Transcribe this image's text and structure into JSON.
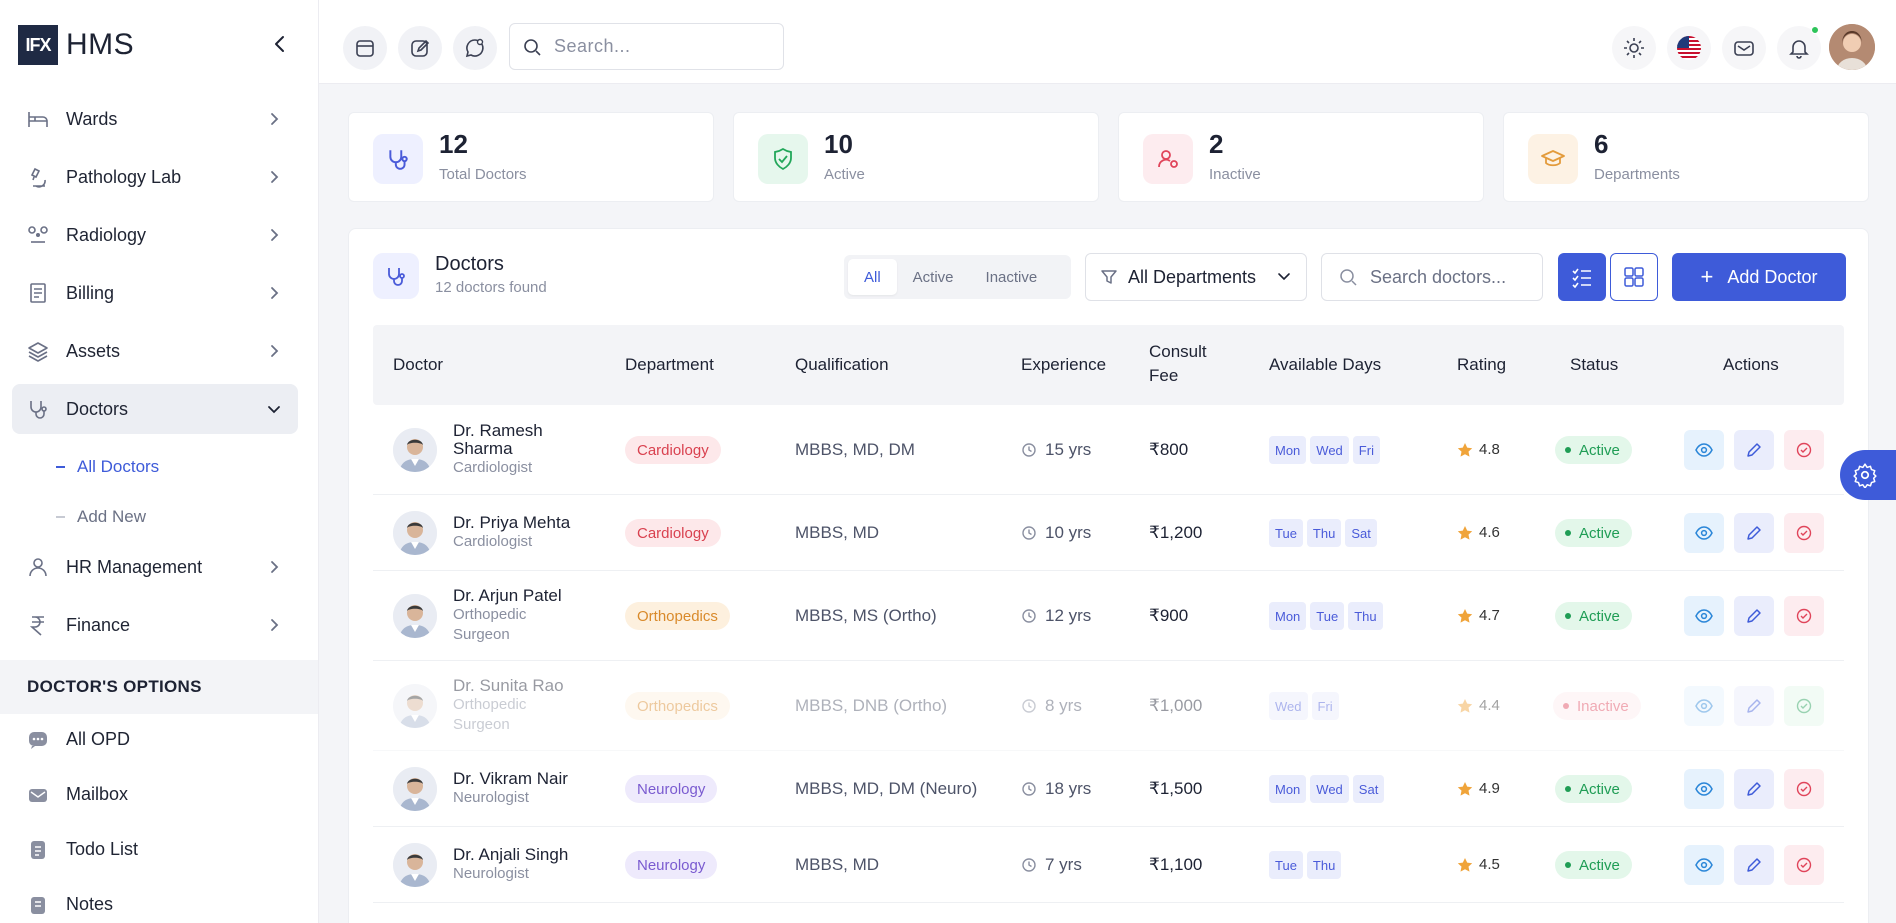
{
  "brand": {
    "logo_text": "IFX",
    "name": "HMS"
  },
  "sidebar": {
    "items": [
      {
        "label": "Wards"
      },
      {
        "label": "Pathology Lab"
      },
      {
        "label": "Radiology"
      },
      {
        "label": "Billing"
      },
      {
        "label": "Assets"
      },
      {
        "label": "Doctors"
      },
      {
        "label": "HR Management"
      },
      {
        "label": "Finance"
      }
    ],
    "doctors_sub": [
      {
        "label": "All Doctors"
      },
      {
        "label": "Add New"
      }
    ],
    "section_title": "DOCTOR'S OPTIONS",
    "options": [
      {
        "label": "All OPD"
      },
      {
        "label": "Mailbox"
      },
      {
        "label": "Todo List"
      },
      {
        "label": "Notes"
      }
    ]
  },
  "topbar": {
    "search_placeholder": "Search..."
  },
  "stats": [
    {
      "value": "12",
      "label": "Total Doctors",
      "color": "#4a5bd9",
      "bg": "#eef0ff"
    },
    {
      "value": "10",
      "label": "Active",
      "color": "#22a75a",
      "bg": "#e6f7ed"
    },
    {
      "value": "2",
      "label": "Inactive",
      "color": "#e0445a",
      "bg": "#fdecef"
    },
    {
      "value": "6",
      "label": "Departments",
      "color": "#e39b3b",
      "bg": "#fdf2e4"
    }
  ],
  "panel": {
    "title": "Doctors",
    "subtitle": "12 doctors found",
    "filters": [
      "All",
      "Active",
      "Inactive"
    ],
    "department_filter": "All Departments",
    "search_placeholder": "Search doctors...",
    "add_button": "Add Doctor"
  },
  "table": {
    "headers": {
      "doctor": "Doctor",
      "department": "Department",
      "qualification": "Qualification",
      "experience": "Experience",
      "fee_line1": "Consult",
      "fee_line2": "Fee",
      "days": "Available Days",
      "rating": "Rating",
      "status": "Status",
      "actions": "Actions"
    },
    "rows": [
      {
        "name1": "Dr. Ramesh",
        "name2": "Sharma",
        "spec1": "Cardiologist",
        "spec2": "",
        "dept": "Cardiology",
        "qual": "MBBS, MD, DM",
        "exp": "15 yrs",
        "fee": "₹800",
        "days": [
          "Mon",
          "Wed",
          "Fri"
        ],
        "rating": "4.8",
        "status": "Active"
      },
      {
        "name1": "Dr. Priya Mehta",
        "name2": "",
        "spec1": "Cardiologist",
        "spec2": "",
        "dept": "Cardiology",
        "qual": "MBBS, MD",
        "exp": "10 yrs",
        "fee": "₹1,200",
        "days": [
          "Tue",
          "Thu",
          "Sat"
        ],
        "rating": "4.6",
        "status": "Active"
      },
      {
        "name1": "Dr. Arjun Patel",
        "name2": "",
        "spec1": "Orthopedic",
        "spec2": "Surgeon",
        "dept": "Orthopedics",
        "qual": "MBBS, MS (Ortho)",
        "exp": "12 yrs",
        "fee": "₹900",
        "days": [
          "Mon",
          "Tue",
          "Thu"
        ],
        "rating": "4.7",
        "status": "Active"
      },
      {
        "name1": "Dr. Sunita Rao",
        "name2": "",
        "spec1": "Orthopedic",
        "spec2": "Surgeon",
        "dept": "Orthopedics",
        "qual": "MBBS, DNB (Ortho)",
        "exp": "8 yrs",
        "fee": "₹1,000",
        "days": [
          "Wed",
          "Fri"
        ],
        "rating": "4.4",
        "status": "Inactive"
      },
      {
        "name1": "Dr. Vikram Nair",
        "name2": "",
        "spec1": "Neurologist",
        "spec2": "",
        "dept": "Neurology",
        "qual": "MBBS, MD, DM (Neuro)",
        "exp": "18 yrs",
        "fee": "₹1,500",
        "days": [
          "Mon",
          "Wed",
          "Sat"
        ],
        "rating": "4.9",
        "status": "Active"
      },
      {
        "name1": "Dr. Anjali Singh",
        "name2": "",
        "spec1": "Neurologist",
        "spec2": "",
        "dept": "Neurology",
        "qual": "MBBS, MD",
        "exp": "7 yrs",
        "fee": "₹1,100",
        "days": [
          "Tue",
          "Thu"
        ],
        "rating": "4.5",
        "status": "Active"
      }
    ]
  },
  "colors": {
    "accent": "#3e5bd9",
    "cardiology_bg": "#fde8ea",
    "cardiology_fg": "#d9414f",
    "ortho_bg": "#fdf0de",
    "ortho_fg": "#d98a2b",
    "neuro_bg": "#eeeafc",
    "neuro_fg": "#7a5bd0",
    "active_bg": "#e3f7ea",
    "active_fg": "#1f9d55",
    "inactive_bg": "#fdecef",
    "inactive_fg": "#e0445a"
  }
}
